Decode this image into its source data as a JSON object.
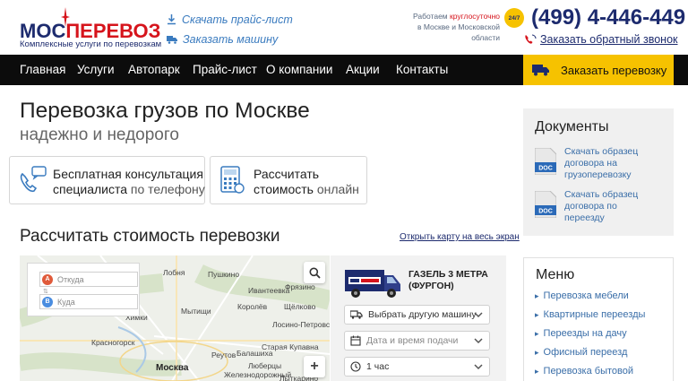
{
  "header": {
    "logo": {
      "name_left": "МОС",
      "name_right": "ПЕРЕВОЗ",
      "tagline": "Комплексные услуги по перевозкам"
    },
    "links": [
      {
        "label": "Скачать прайс-лист",
        "icon": "download-icon"
      },
      {
        "label": "Заказать машину",
        "icon": "truck-icon"
      }
    ],
    "hours_line1_a": "Работаем ",
    "hours_line1_b": "круглосуточно",
    "hours_line2": "в Москве и Московской",
    "hours_line3": "области",
    "badge": "24/7",
    "phone": "(499) 4-446-449",
    "callback": "Заказать обратный звонок"
  },
  "nav": {
    "items": [
      "Главная",
      "Услуги",
      "Автопарк",
      "Прайс-лист",
      "О компании",
      "Акции",
      "Контакты"
    ],
    "order_button": "Заказать перевозку"
  },
  "hero": {
    "title": "Перевозка грузов по Москве",
    "subtitle": "надежно и недорого"
  },
  "cards": [
    {
      "line1": "Бесплатная консультация",
      "line2_bold": "специалиста",
      "line2_light": " по телефону",
      "icon": "phone-chat-icon"
    },
    {
      "line1": "Рассчитать",
      "line2_bold": "стоимость",
      "line2_light": " онлайн",
      "icon": "calculator-icon"
    }
  ],
  "calculator": {
    "title": "Рассчитать стоимость перевозки",
    "map_link": "Открыть карту на весь экран",
    "map": {
      "from_placeholder": "Откуда",
      "to_placeholder": "Куда",
      "pin_from": "А",
      "pin_to": "В",
      "zoom_in": "+",
      "labels": [
        "Пушкино",
        "Мытищи",
        "Королёв",
        "Щёлково",
        "Химки",
        "Лобня",
        "Красногорск",
        "Балашиха",
        "Реутов",
        "Москва",
        "Люберцы",
        "Лосино-Петровский",
        "Старая Купавна",
        "Железнодорожный",
        "Ивантеевка",
        "Фрязино",
        "Лыткарино"
      ]
    },
    "vehicle_name_1": "ГАЗЕЛЬ 3 МЕТРА",
    "vehicle_name_2": "(ФУРГОН)",
    "select_vehicle": "Выбрать другую машину",
    "datetime_placeholder": "Дата и время подачи",
    "hours": "1 час"
  },
  "sidebar": {
    "docs_title": "Документы",
    "docs": [
      {
        "line1": "Скачать образец",
        "line2": "договора на",
        "line3": "грузоперевозку",
        "badge": "DOC"
      },
      {
        "line1": "Скачать образец",
        "line2": "договора по",
        "line3": "переезду",
        "badge": "DOC"
      }
    ],
    "menu_title": "Меню",
    "menu": [
      "Перевозка мебели",
      "Квартирные переезды",
      "Переезды на дачу",
      "Офисный переезд",
      "Перевозка бытовой"
    ]
  },
  "colors": {
    "brand_blue": "#1d2b6e",
    "brand_red": "#d6141c",
    "accent_yellow": "#f6c200",
    "link_blue": "#3a6ea8"
  }
}
